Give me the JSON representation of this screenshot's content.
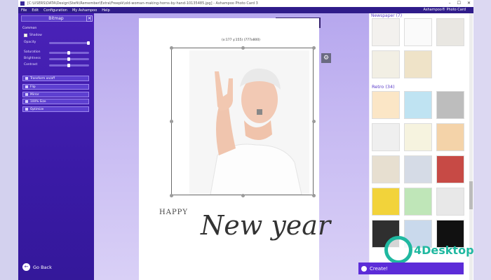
{
  "window": {
    "title": "[C:\\USERS\\DATA\\Design\\Stefk\\Remember\\Extra\\Freepik\\old-woman-making-horns-by-hand-10135485.jpg] - Ashampoo Photo Card 3",
    "controls": [
      "–",
      "☐",
      "✕"
    ]
  },
  "menu": {
    "items": [
      "File",
      "Edit",
      "Configuration",
      "My Ashampoo",
      "Help"
    ],
    "brand": "Ashampoo® Photo Card"
  },
  "left_panel": {
    "title": "Bitmap",
    "close": "✕",
    "section": "Common",
    "shadow_label": "Shadow",
    "sliders": [
      {
        "label": "Opacity",
        "value": 0.96
      },
      {
        "label": "Saturation",
        "value": 0.45
      },
      {
        "label": "Brightness",
        "value": 0.45
      },
      {
        "label": "Contrast",
        "value": 0.45
      }
    ],
    "buttons": [
      {
        "label": "Transform on/off"
      },
      {
        "label": "Flip"
      },
      {
        "label": "Mirror"
      },
      {
        "label": "100% Size"
      },
      {
        "label": "Optimize"
      }
    ],
    "go_back": "Go Back"
  },
  "canvas": {
    "toolbar_icons": [
      "image-icon",
      "text-icon",
      "shapes-icon",
      "frame-icon"
    ],
    "coords": "(x:177 y:155) (777x800)",
    "gear": "⚙",
    "happy": "HAPPY",
    "script": "New year"
  },
  "right_panel": {
    "header": "Newspaper (7)",
    "retro": "Retro (34)",
    "create": "Create!",
    "watermark": "4Desktop"
  }
}
